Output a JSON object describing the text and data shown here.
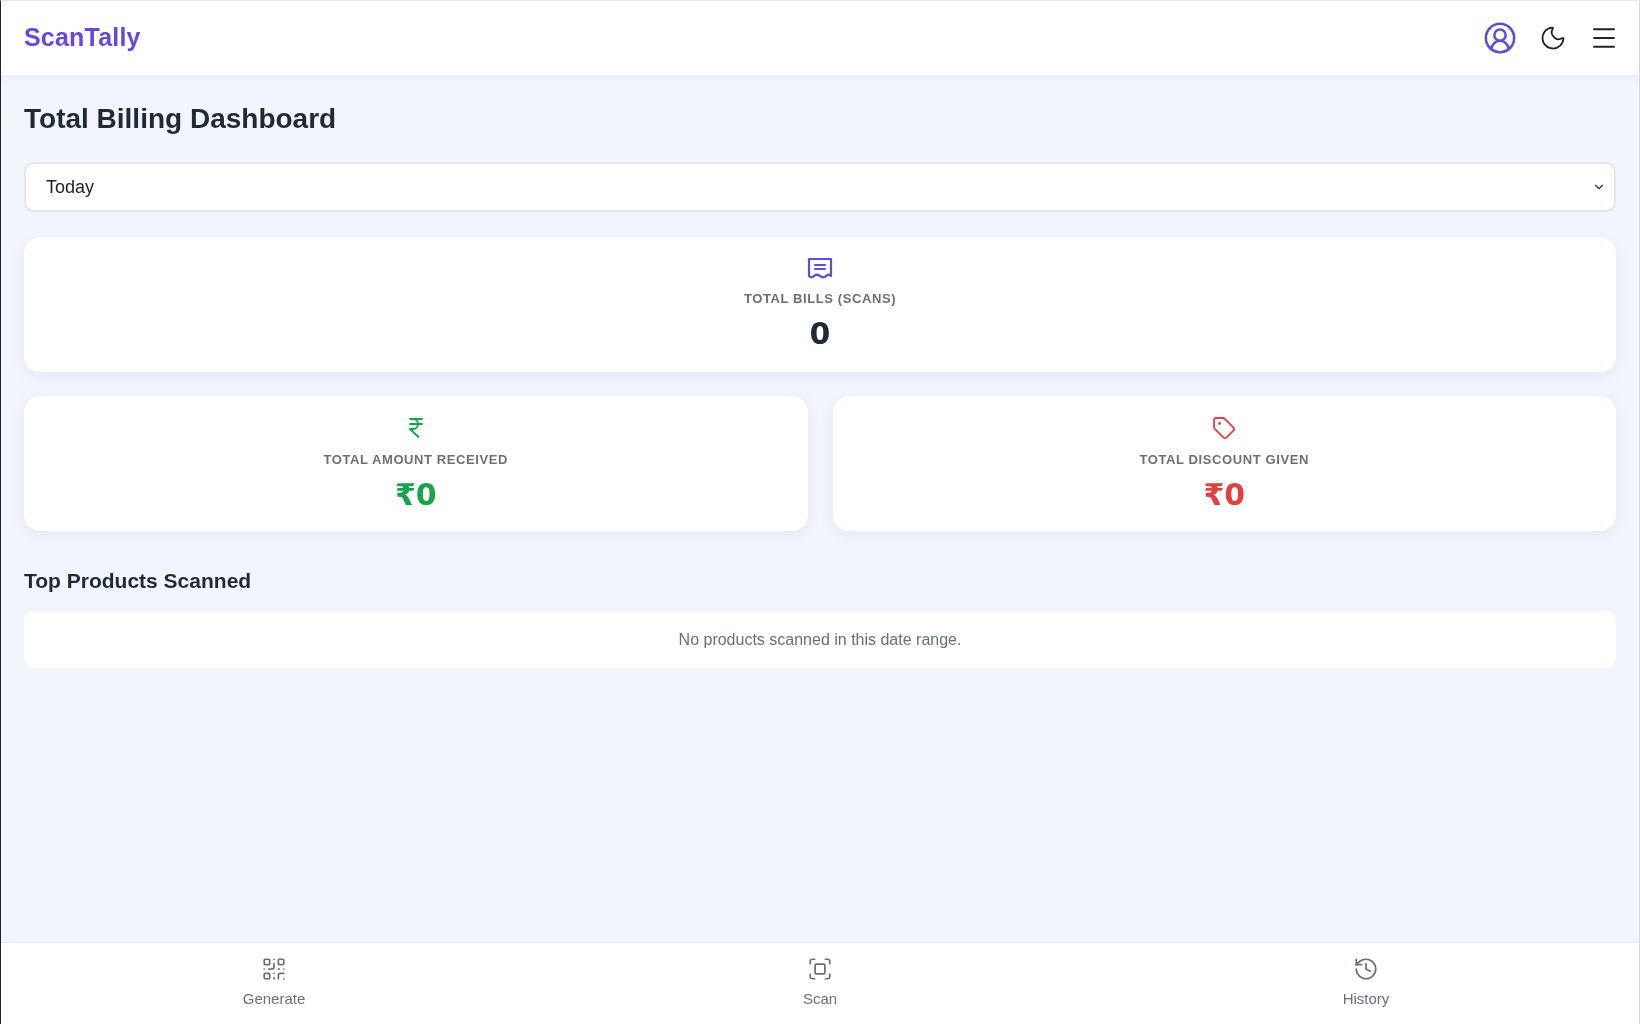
{
  "header": {
    "logo": "ScanTally"
  },
  "page": {
    "title": "Total Billing Dashboard"
  },
  "date_range": {
    "value": "Today"
  },
  "stats": [
    {
      "kind": "bills",
      "label": "TOTAL BILLS (SCANS)",
      "value": "0",
      "color": "#5b4fd6"
    },
    {
      "kind": "amount",
      "label": "TOTAL AMOUNT RECEIVED",
      "value": "₹0",
      "color": "#16a34a"
    },
    {
      "kind": "discount",
      "label": "TOTAL DISCOUNT GIVEN",
      "value": "₹0",
      "color": "#e53e3e"
    }
  ],
  "top_products": {
    "title": "Top Products Scanned",
    "empty_message": "No products scanned in this date range."
  },
  "bottom_nav": [
    {
      "kind": "generate",
      "label": "Generate",
      "selected": false
    },
    {
      "kind": "scan",
      "label": "Scan",
      "selected": false
    },
    {
      "kind": "history",
      "label": "History",
      "selected": false
    }
  ]
}
